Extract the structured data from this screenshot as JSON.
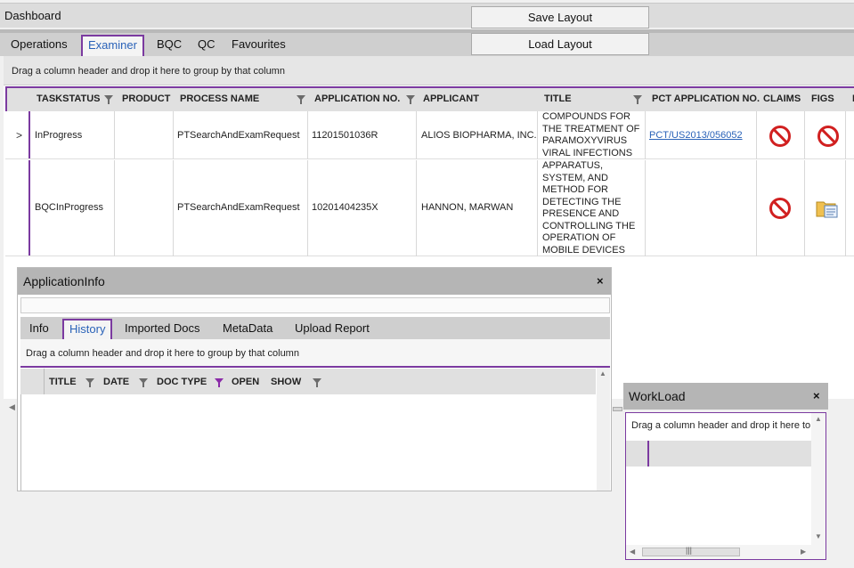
{
  "dashboard": {
    "title": "Dashboard",
    "save_layout": "Save Layout",
    "load_layout": "Load Layout"
  },
  "tabs": [
    {
      "label": "Operations"
    },
    {
      "label": "Examiner",
      "active": true
    },
    {
      "label": "BQC"
    },
    {
      "label": "QC"
    },
    {
      "label": "Favourites"
    }
  ],
  "grid": {
    "group_hint": "Drag a column header and drop it here to group by that column",
    "columns": [
      "TASKSTATUS",
      "PRODUCT",
      "PROCESS NAME",
      "APPLICATION NO.",
      "APPLICANT",
      "TITLE",
      "PCT APPLICATION NO.",
      "CLAIMS",
      "FIGS",
      "D"
    ],
    "rows": [
      {
        "chevron": ">",
        "taskstatus": "InProgress",
        "product": "",
        "process_name": "PTSearchAndExamRequest",
        "application_no": "11201501036R",
        "applicant": "ALIOS BIOPHARMA, INC.",
        "title": "COMPOUNDS FOR THE TREATMENT OF PARAMOXYVIRUS VIRAL INFECTIONS",
        "pct_application_no": "PCT/US2013/056052",
        "claims_icon": "no-entry-icon",
        "figs_icon": "no-entry-icon"
      },
      {
        "chevron": "",
        "taskstatus": "BQCInProgress",
        "product": "",
        "process_name": "PTSearchAndExamRequest",
        "application_no": "10201404235X",
        "applicant": "HANNON, MARWAN",
        "title": "APPARATUS, SYSTEM, AND METHOD FOR DETECTING THE PRESENCE AND CONTROLLING THE OPERATION OF MOBILE DEVICES WITHIN A VEHICLE",
        "pct_application_no": "",
        "claims_icon": "no-entry-icon",
        "figs_icon": "folder-document-icon"
      }
    ]
  },
  "application_info": {
    "title": "ApplicationInfo",
    "close": "×",
    "tabs": [
      {
        "label": "Info"
      },
      {
        "label": "History",
        "active": true
      },
      {
        "label": "Imported Docs"
      },
      {
        "label": "MetaData"
      },
      {
        "label": "Upload Report"
      }
    ],
    "group_hint": "Drag a column header and drop it here to group by that column",
    "columns": [
      "TITLE",
      "DATE",
      "DOC TYPE",
      "OPEN",
      "SHOW"
    ]
  },
  "workload": {
    "title": "WorkLoad",
    "close": "×",
    "group_hint": "Drag a column header and drop it here to",
    "scroll_grip": "|||"
  },
  "colors": {
    "accent": "#7b3aa0",
    "link": "#2a62b8",
    "no_entry": "#d12020"
  }
}
